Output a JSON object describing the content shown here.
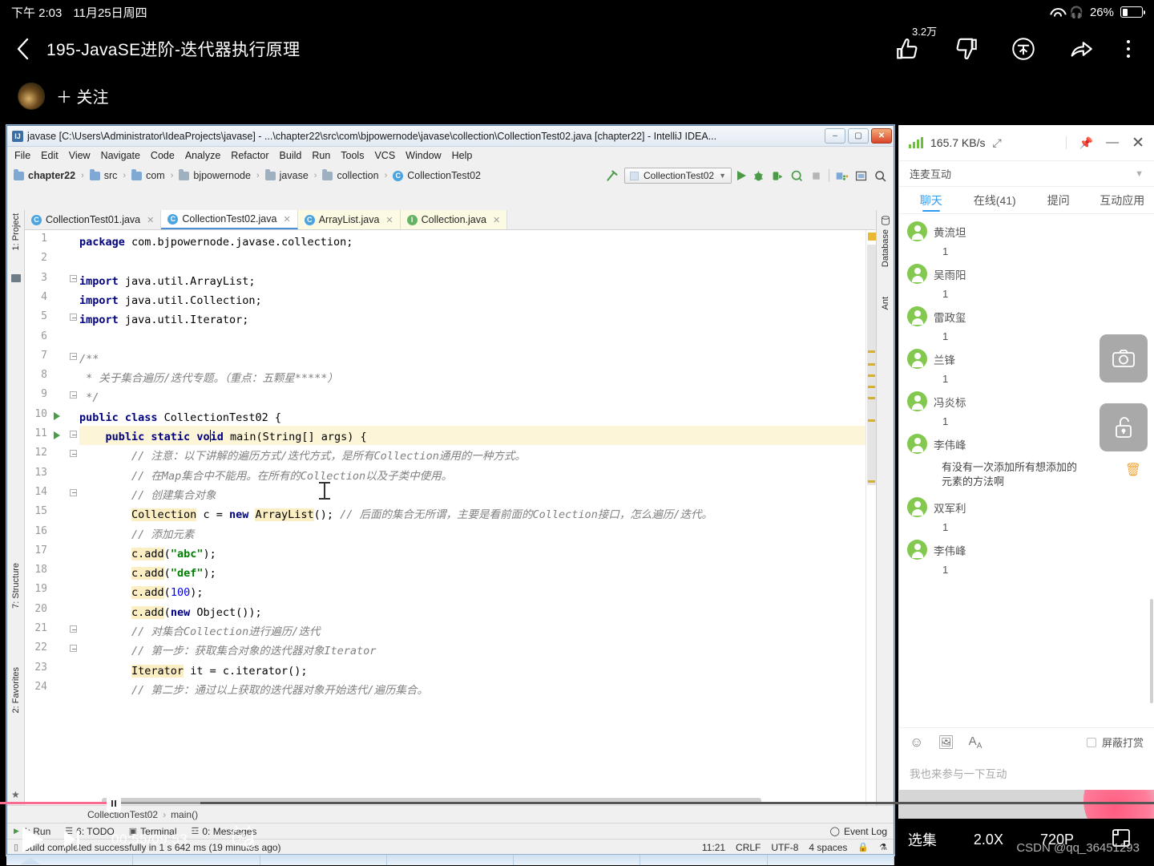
{
  "status_bar": {
    "time": "下午 2:03",
    "date": "11月25日周四",
    "battery": "26%",
    "wifi_icon": "wifi-icon",
    "headphone_icon": "headphone-icon"
  },
  "video_header": {
    "back_icon": "back-chevron-icon",
    "title": "195-JavaSE进阶-迭代器执行原理",
    "like_icon": "thumbs-up-icon",
    "like_count": "3.2万",
    "dislike_icon": "thumbs-down-icon",
    "coin_icon": "coin-icon",
    "share_icon": "share-icon",
    "more_icon": "kebab-menu-icon"
  },
  "follow_row": {
    "avatar": "uploader-avatar",
    "follow_label": "＋ 关注"
  },
  "ide": {
    "title": "javase [C:\\Users\\Administrator\\IdeaProjects\\javase] - ...\\chapter22\\src\\com\\bjpowernode\\javase\\collection\\CollectionTest02.java [chapter22] - IntelliJ IDEA...",
    "window_buttons": {
      "minimize": "–",
      "maximize": "▢",
      "close": "✕"
    },
    "menu": [
      "File",
      "Edit",
      "View",
      "Navigate",
      "Code",
      "Analyze",
      "Refactor",
      "Build",
      "Run",
      "Tools",
      "VCS",
      "Window",
      "Help"
    ],
    "breadcrumbs": [
      "chapter22",
      "src",
      "com",
      "bjpowernode",
      "javase",
      "collection",
      "CollectionTest02"
    ],
    "run_config": "CollectionTest02",
    "toolbar_icons": [
      "build-hammer-icon",
      "run-icon",
      "debug-icon",
      "run-with-coverage-icon",
      "profile-icon",
      "stop-icon",
      "project-structure-icon",
      "layout-icon",
      "search-everywhere-icon"
    ],
    "left_toolwindows": [
      "1: Project",
      "7: Structure",
      "2: Favorites"
    ],
    "right_toolwindows": [
      "Database",
      "Ant"
    ],
    "tabs": [
      {
        "label": "CollectionTest01.java",
        "icon": "java-class-icon",
        "active": false,
        "style": "normal"
      },
      {
        "label": "CollectionTest02.java",
        "icon": "java-class-icon",
        "active": true,
        "style": "normal"
      },
      {
        "label": "ArrayList.java",
        "icon": "java-class-readonly-icon",
        "active": false,
        "style": "yellow"
      },
      {
        "label": "Collection.java",
        "icon": "java-interface-icon",
        "active": false,
        "style": "yellow"
      }
    ],
    "code_lines": [
      {
        "n": 1,
        "html": "<span class='kw'>package</span> com.bjpowernode.javase.collection;"
      },
      {
        "n": 2,
        "html": ""
      },
      {
        "n": 3,
        "html": "<span class='kw'>import</span> java.util.ArrayList;"
      },
      {
        "n": 4,
        "html": "<span class='kw'>import</span> java.util.Collection;"
      },
      {
        "n": 5,
        "html": "<span class='kw'>import</span> java.util.Iterator;"
      },
      {
        "n": 6,
        "html": ""
      },
      {
        "n": 7,
        "html": "<span class='cmt'>/**</span>"
      },
      {
        "n": 8,
        "html": "<span class='cmt'> * 关于集合遍历/迭代专题。（重点：五颗星*****）</span>"
      },
      {
        "n": 9,
        "html": "<span class='cmt'> */</span>"
      },
      {
        "n": 10,
        "html": "<span class='kw'>public class</span> CollectionTest02 {"
      },
      {
        "n": 11,
        "html": "    <span class='kw'>public static</span> <span class='kw'>vo</span><span class='caret'></span><span class='kw'>id</span> main(String[] args) {"
      },
      {
        "n": 12,
        "html": "        <span class='cmt'>// 注意：以下讲解的遍历方式/迭代方式，是所有Collection通用的一种方式。</span>"
      },
      {
        "n": 13,
        "html": "        <span class='cmt'>// 在Map集合中不能用。在所有的Collection以及子类中使用。</span>"
      },
      {
        "n": 14,
        "html": "        <span class='cmt'>// 创建集合对象</span>"
      },
      {
        "n": 15,
        "html": "        <span class='hlbox'>Collection</span> c = <span class='kw'>new</span> <span class='hlbox'>ArrayList</span>(); <span class='cmt'>// 后面的集合无所谓，主要是看前面的Collection接口，怎么遍历/迭代。</span>"
      },
      {
        "n": 16,
        "html": "        <span class='cmt'>// 添加元素</span>"
      },
      {
        "n": 17,
        "html": "        <span class='hlbox'>c.add</span>(<span class='str'>\"abc\"</span>);"
      },
      {
        "n": 18,
        "html": "        <span class='hlbox'>c.add</span>(<span class='str'>\"def\"</span>);"
      },
      {
        "n": 19,
        "html": "        <span class='hlbox'>c.add</span>(<span class='num'>100</span>);"
      },
      {
        "n": 20,
        "html": "        <span class='hlbox'>c.add</span>(<span class='kw'>new</span> Object());"
      },
      {
        "n": 21,
        "html": "        <span class='cmt'>// 对集合Collection进行遍历/迭代</span>"
      },
      {
        "n": 22,
        "html": "        <span class='cmt'>// 第一步：获取集合对象的迭代器对象Iterator</span>"
      },
      {
        "n": 23,
        "html": "        <span class='hlbox'>Iterator</span> it = c.iterator();"
      },
      {
        "n": 24,
        "html": "        <span class='cmt'>// 第二步：通过以上获取的迭代器对象开始迭代/遍历集合。</span>"
      }
    ],
    "navbar": [
      "CollectionTest02",
      "main()"
    ],
    "status_tools": [
      {
        "label": "4: Run",
        "icon": "run-icon"
      },
      {
        "label": "6: TODO",
        "icon": "todo-icon"
      },
      {
        "label": "Terminal",
        "icon": "terminal-icon"
      },
      {
        "label": "0: Messages",
        "icon": "messages-icon"
      }
    ],
    "event_log": "Event Log",
    "build_message": "Build completed successfully in 1 s 642 ms (19 minutes ago)",
    "caret_pos": "11:21",
    "line_sep": "CRLF",
    "encoding": "UTF-8",
    "indent": "4 spaces"
  },
  "chat_panel": {
    "bitrate": "165.7 KB/s",
    "expand_icon": "expand-icon",
    "pin_icon": "pin-icon",
    "minimize_icon": "minimize-icon",
    "close_icon": "close-icon",
    "selector_label": "连麦互动",
    "selector_chevron": "chevron-down-icon",
    "tabs": [
      {
        "label": "聊天",
        "active": true
      },
      {
        "label": "在线(41)",
        "active": false
      },
      {
        "label": "提问",
        "active": false
      },
      {
        "label": "互动应用",
        "active": false
      }
    ],
    "messages": [
      {
        "nick": "黄流坦",
        "text": "1"
      },
      {
        "nick": "吴雨阳",
        "text": "1"
      },
      {
        "nick": "雷政玺",
        "text": "1"
      },
      {
        "nick": "兰锋",
        "text": "1"
      },
      {
        "nick": "冯炎标",
        "text": "1"
      },
      {
        "nick": "李伟峰",
        "text": "有没有一次添加所有想添加的元素的方法啊",
        "wide": true
      },
      {
        "nick": "双军利",
        "text": "1"
      },
      {
        "nick": "李伟峰",
        "text": "1"
      }
    ],
    "side_buttons": [
      "camera-icon",
      "unlock-icon"
    ],
    "delete_icon": "trash-icon",
    "tool_icons": [
      "emoji-icon",
      "image-icon",
      "font-size-icon"
    ],
    "block_gift_label": "屏蔽打赏",
    "input_placeholder": "我也来参与一下互动"
  },
  "player": {
    "play_icon": "play-icon",
    "next_icon": "next-episode-icon",
    "time": "00:55/09:53",
    "danmaku_icon": "danmaku-off-icon",
    "episodes_label": "选集",
    "speed_label": "2.0X",
    "quality_label": "720P",
    "fullscreen_icon": "fullscreen-icon",
    "progress_percent": 9.7,
    "buffered_percent": 17.4
  },
  "watermark": "CSDN @qq_36451293"
}
